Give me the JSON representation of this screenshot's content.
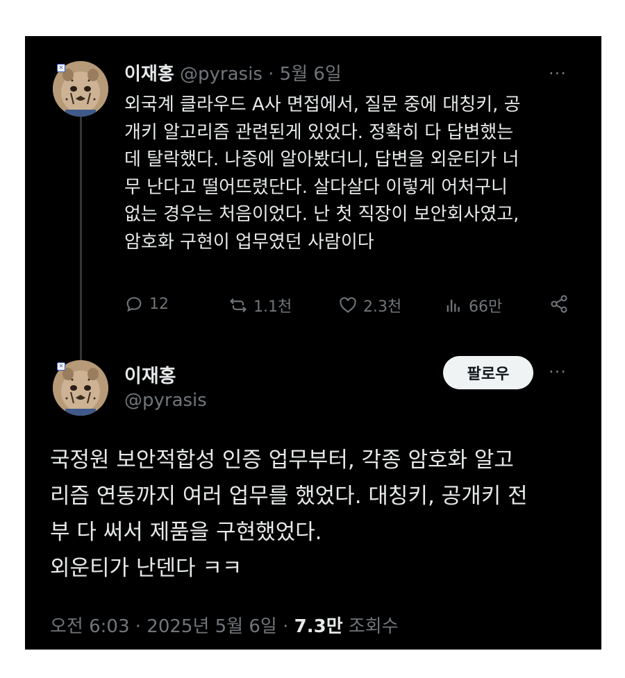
{
  "tweet1": {
    "display_name": "이재홍",
    "handle": "@pyrasis",
    "separator": "·",
    "date": "5월 6일",
    "more": "···",
    "text": "외국계 클라우드 A사 면접에서, 질문 중에 대칭키, 공\n개키 알고리즘 관련된게 있었다. 정확히 다 답변했는\n데 탈락했다. 나중에 알아봤더니, 답변을 외운티가 너\n무 난다고 떨어뜨렸단다. 살다살다 이렇게 어처구니\n없는 경우는 처음이었다. 난 첫 직장이 보안회사였고,\n암호화 구현이 업무였던 사람이다",
    "actions": {
      "replies": "12",
      "reposts": "1.1천",
      "likes": "2.3천",
      "views": "66만"
    }
  },
  "tweet2": {
    "display_name": "이재홍",
    "handle": "@pyrasis",
    "follow_label": "팔로우",
    "more": "···",
    "text": "국정원 보안적합성 인증 업무부터, 각종 암호화 알고\n리즘 연동까지 여러 업무를 했었다. 대칭키, 공개키 전\n부 다 써서 제품을 구현했었다.\n외운티가 난덴다 ㅋㅋ",
    "time": "오전 6:03",
    "sep1": "·",
    "date": "2025년 5월 6일",
    "sep2": "·",
    "views_count": "7.3만",
    "views_label": "조회수"
  },
  "icons": [
    "reply-icon",
    "repost-icon",
    "like-icon",
    "views-icon",
    "share-icon"
  ],
  "colors": {
    "background": "#000000",
    "text": "#e7e9ea",
    "muted": "#71767b",
    "follow_button_bg": "#eff3f4"
  }
}
